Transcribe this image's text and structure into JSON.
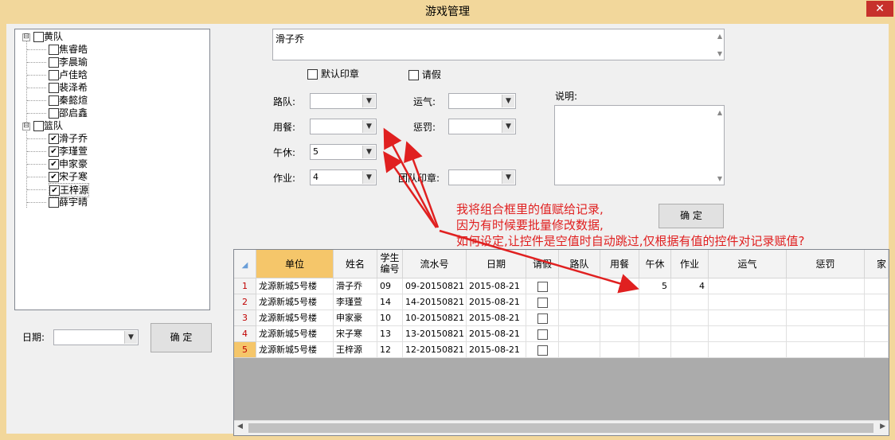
{
  "window": {
    "title": "游戏管理",
    "close_symbol": "✕"
  },
  "tree": {
    "groups": [
      {
        "label": "黄队",
        "expander": "⊟",
        "members": [
          {
            "label": "焦睿皓",
            "checked": false
          },
          {
            "label": "李晨瑜",
            "checked": false
          },
          {
            "label": "卢佳晗",
            "checked": false
          },
          {
            "label": "裴泽希",
            "checked": false
          },
          {
            "label": "秦懿煊",
            "checked": false
          },
          {
            "label": "邵启鑫",
            "checked": false
          }
        ]
      },
      {
        "label": "篮队",
        "expander": "⊟",
        "members": [
          {
            "label": "滑子乔",
            "checked": true
          },
          {
            "label": "李瑾萱",
            "checked": true
          },
          {
            "label": "申家豪",
            "checked": true
          },
          {
            "label": "宋子寒",
            "checked": true
          },
          {
            "label": "王梓源",
            "checked": true
          },
          {
            "label": "薛宇晴",
            "checked": false
          }
        ]
      }
    ]
  },
  "form": {
    "name_box": "滑子乔",
    "default_seal_label": "默认印章",
    "leave_label": "请假",
    "road_team_label": "路队:",
    "meal_label": "用餐:",
    "nap_label": "午休:",
    "nap_value": "5",
    "homework_label": "作业:",
    "homework_value": "4",
    "luck_label": "运气:",
    "penalty_label": "惩罚:",
    "team_seal_label": "团队印章:",
    "note_label": "说明:",
    "confirm_label": "确 定"
  },
  "left": {
    "date_label": "日期:",
    "confirm_label": "确 定"
  },
  "annotation": {
    "line1": "我将组合框里的值赋给记录,",
    "line2": "因为有时候要批量修改数据,",
    "line3": "如何设定,让控件是空值时自动跳过,仅根据有值的控件对记录赋值?"
  },
  "grid": {
    "headers": {
      "unit": "单位",
      "name": "姓名",
      "student_no": "学生编号",
      "serial": "流水号",
      "date": "日期",
      "leave": "请假",
      "road": "路队",
      "meal": "用餐",
      "nap": "午休",
      "homework": "作业",
      "luck": "运气",
      "penalty": "惩罚",
      "more": "家"
    },
    "rows": [
      {
        "n": "1",
        "unit": "龙源新城5号楼",
        "name": "滑子乔",
        "sno": "09",
        "serial": "09-20150821",
        "date": "2015-08-21",
        "nap": "5",
        "homework": "4"
      },
      {
        "n": "2",
        "unit": "龙源新城5号楼",
        "name": "李瑾萱",
        "sno": "14",
        "serial": "14-20150821",
        "date": "2015-08-21",
        "nap": "",
        "homework": ""
      },
      {
        "n": "3",
        "unit": "龙源新城5号楼",
        "name": "申家豪",
        "sno": "10",
        "serial": "10-20150821",
        "date": "2015-08-21",
        "nap": "",
        "homework": ""
      },
      {
        "n": "4",
        "unit": "龙源新城5号楼",
        "name": "宋子寒",
        "sno": "13",
        "serial": "13-20150821",
        "date": "2015-08-21",
        "nap": "",
        "homework": ""
      },
      {
        "n": "5",
        "unit": "龙源新城5号楼",
        "name": "王梓源",
        "sno": "12",
        "serial": "12-20150821",
        "date": "2015-08-21",
        "nap": "",
        "homework": ""
      }
    ]
  },
  "colors": {
    "annotation": "#e02020",
    "title_bg": "#f2d79b",
    "close": "#c7312b",
    "unit_header": "#f5c66a"
  }
}
